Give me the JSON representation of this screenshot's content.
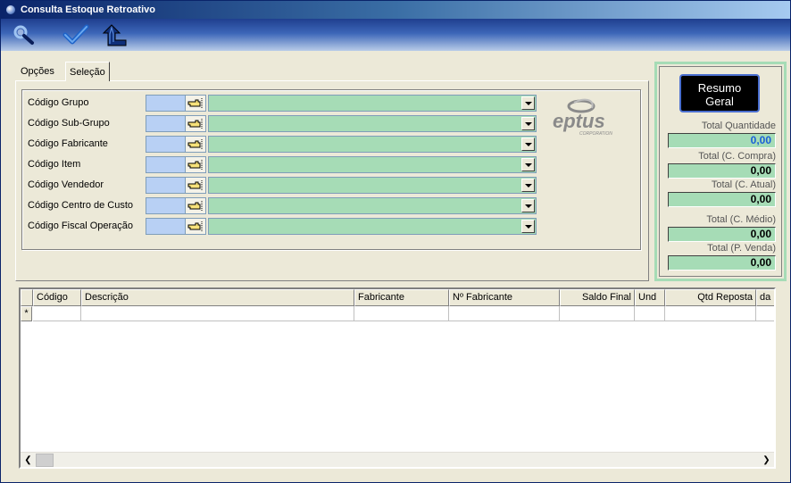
{
  "window": {
    "title": "Consulta Estoque Retroativo"
  },
  "toolbar": {
    "buttons": [
      {
        "icon": "magnifier-icon"
      },
      {
        "icon": "checkmark-icon"
      },
      {
        "icon": "return-arrow-icon"
      }
    ]
  },
  "tabs": [
    {
      "label": "Opções",
      "active": false
    },
    {
      "label": "Seleção",
      "active": true
    }
  ],
  "filters": [
    {
      "label": "Código Grupo",
      "code": "",
      "description": ""
    },
    {
      "label": "Código Sub-Grupo",
      "code": "",
      "description": ""
    },
    {
      "label": "Código Fabricante",
      "code": "",
      "description": ""
    },
    {
      "label": "Código Item",
      "code": "",
      "description": ""
    },
    {
      "label": "Código Vendedor",
      "code": "",
      "description": ""
    },
    {
      "label": "Código Centro de Custo",
      "code": "",
      "description": ""
    },
    {
      "label": "Código Fiscal Operação",
      "code": "",
      "description": ""
    }
  ],
  "logo": {
    "text": "eptus",
    "subtext": "CORPORATION"
  },
  "summary": {
    "button_label_line1": "Resumo",
    "button_label_line2": "Geral",
    "totals": [
      {
        "label": "Total Quantidade",
        "value": "0,00",
        "highlight_color": "#1a5fd8"
      },
      {
        "label": "Total (C. Compra)",
        "value": "0,00"
      },
      {
        "label": "Total (C. Atual)",
        "value": "0,00"
      },
      {
        "label": "Total (C. Médio)",
        "value": "0,00"
      },
      {
        "label": "Total (P. Venda)",
        "value": "0,00"
      }
    ]
  },
  "grid": {
    "columns": [
      {
        "label": "Código"
      },
      {
        "label": "Descrição"
      },
      {
        "label": "Fabricante"
      },
      {
        "label": "Nº Fabricante"
      },
      {
        "label": "Saldo Final"
      },
      {
        "label": "Und"
      },
      {
        "label": "Qtd Reposta"
      },
      {
        "label": "da"
      }
    ],
    "new_row_marker": "*"
  },
  "colors": {
    "accent_green": "#a6dcb6",
    "code_blue": "#b8d0f4",
    "title_blue": "#0a246a"
  }
}
